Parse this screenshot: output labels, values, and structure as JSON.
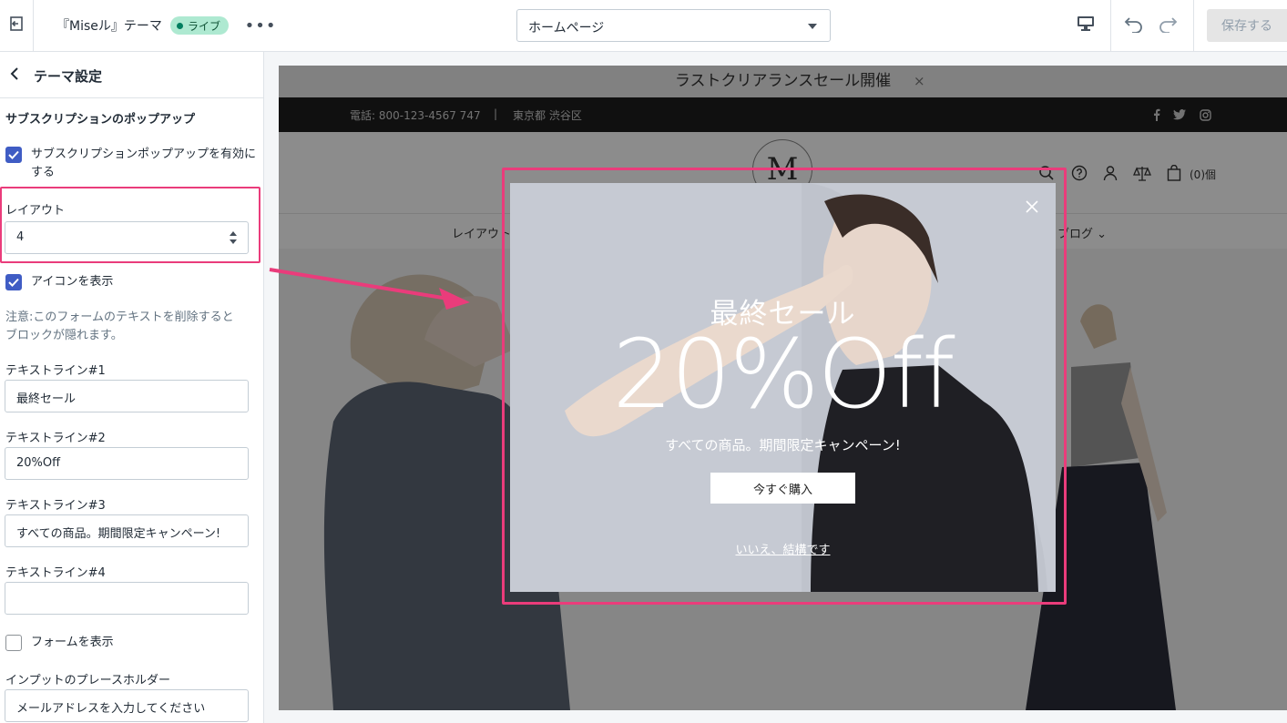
{
  "topbar": {
    "theme_name": "『Miseル』テーマ",
    "live_badge": "ライブ",
    "more": "•••",
    "page_select": "ホームページ",
    "save_label": "保存する"
  },
  "sidebar": {
    "title": "テーマ設定",
    "section_title": "サブスクリプションのポップアップ",
    "enable_popup": {
      "label": "サブスクリプションポップアップを有効にする",
      "checked": true
    },
    "layout": {
      "label": "レイアウト",
      "value": "4"
    },
    "show_icon": {
      "label": "アイコンを表示",
      "checked": true
    },
    "note": "注意:このフォームのテキストを削除するとブロックが隠れます。",
    "text_line_1": {
      "label": "テキストライン#1",
      "value": "最終セール"
    },
    "text_line_2": {
      "label": "テキストライン#2",
      "value": "20%Off"
    },
    "text_line_3": {
      "label": "テキストライン#3",
      "value": "すべての商品。期間限定キャンペーン!"
    },
    "text_line_4": {
      "label": "テキストライン#4",
      "value": ""
    },
    "show_form": {
      "label": "フォームを表示",
      "checked": false
    },
    "placeholder_field": {
      "label": "インプットのプレースホルダー",
      "value": "メールアドレスを入力してください"
    }
  },
  "preview": {
    "announcement": "ラストクリアランスセール開催",
    "announcement_close": "×",
    "phone": "電話: 800-123-4567 747",
    "separator": "|",
    "address": "東京都 渋谷区",
    "logo_letter": "M",
    "cart_count": "(0)個",
    "nav_left": "レイアウト",
    "nav_right": "ブログ ⌄",
    "popup": {
      "line1": "最終セール",
      "line2": "20%Off",
      "line3": "すべての商品。期間限定キャンペーン!",
      "buy_button": "今すぐ購入",
      "decline_link": "いいえ、結構です"
    }
  },
  "colors": {
    "accent_highlight": "#ea3c7b",
    "checkbox": "#3f5cc4",
    "live_badge_bg": "#aee9d1",
    "info_bar": "#1e1e1e"
  }
}
